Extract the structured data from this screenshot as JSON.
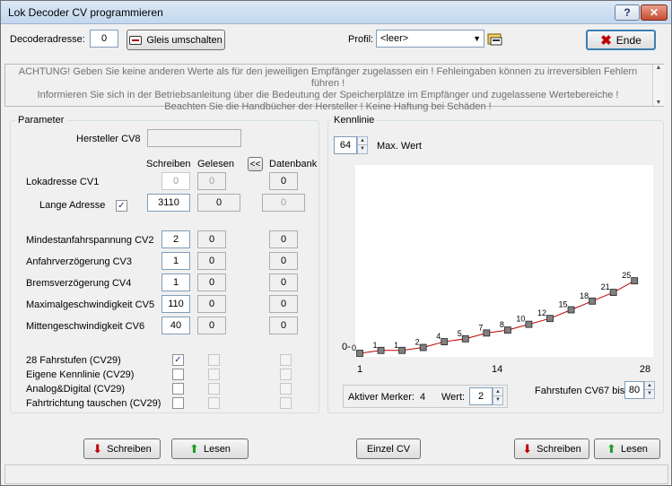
{
  "window": {
    "title": "Lok Decoder CV programmieren",
    "help_label": "?",
    "minimize_label": "—",
    "close_label": "✕"
  },
  "toolbar": {
    "decoder_label": "Decoderadresse:",
    "decoder_value": "0",
    "switch_track_label": "Gleis umschalten",
    "profile_label": "Profil:",
    "profile_value": "<leer>",
    "end_label": "Ende"
  },
  "warning": {
    "line1": "ACHTUNG! Geben Sie keine anderen Werte als für den jeweiligen Empfänger zugelassen ein ! Fehleingaben können zu irreversiblen Fehlern führen !",
    "line2": "Informieren Sie sich in der Betriebsanleitung über die Bedeutung der Speicherplätze im Empfänger und zugelassene Wertebereiche !",
    "line3": "Beachten Sie die Handbücher der Hersteller ! Keine Haftung bei Schäden !"
  },
  "parameters": {
    "group_title": "Parameter",
    "manufacturer_label": "Hersteller CV8",
    "manufacturer_value": "",
    "col_write": "Schreiben",
    "col_read": "Gelesen",
    "copy_button": "<<",
    "col_db": "Datenbank",
    "loco_address": {
      "label": "Lokadresse CV1",
      "write": "0",
      "read": "0",
      "db": "0"
    },
    "long_address": {
      "label": "Lange Adresse",
      "checked": "✓",
      "write": "3110",
      "read": "0",
      "db": "0"
    },
    "rows": [
      {
        "label": "Mindestanfahrspannung CV2",
        "write": "2",
        "read": "0",
        "db": "0"
      },
      {
        "label": "Anfahrverzögerung CV3",
        "write": "1",
        "read": "0",
        "db": "0"
      },
      {
        "label": "Bremsverzögerung CV4",
        "write": "1",
        "read": "0",
        "db": "0"
      },
      {
        "label": "Maximalgeschwindigkeit CV5",
        "write": "110",
        "read": "0",
        "db": "0"
      },
      {
        "label": "Mittengeschwindigkeit CV6",
        "write": "40",
        "read": "0",
        "db": "0"
      }
    ],
    "checks": [
      {
        "label": "28 Fahrstufen (CV29)",
        "mark": "✓"
      },
      {
        "label": "Eigene Kennlinie (CV29)",
        "mark": ""
      },
      {
        "label": "Analog&Digital (CV29)",
        "mark": ""
      },
      {
        "label": "Fahrtrichtung tauschen (CV29)",
        "mark": ""
      }
    ]
  },
  "curve": {
    "group_title": "Kennlinie",
    "max_value": "64",
    "max_label": "Max. Wert",
    "y_zero_label": "0-",
    "active_marker_label": "Aktiver Merker:",
    "active_marker_value": "4",
    "value_label": "Wert:",
    "value_value": "2",
    "steps_label": "Fahrstufen CV67 bis",
    "steps_value": "80"
  },
  "chart_data": {
    "type": "line",
    "x": [
      1,
      2,
      3,
      4,
      5,
      6,
      7,
      8,
      9,
      10,
      11,
      12,
      13,
      14
    ],
    "values": [
      0,
      1,
      1,
      2,
      4,
      5,
      7,
      8,
      10,
      12,
      15,
      18,
      21,
      25
    ],
    "xticks": [
      "1",
      "14",
      "28"
    ],
    "ylim": [
      0,
      64
    ]
  },
  "bottom": {
    "write_left": "Schreiben",
    "read_left": "Lesen",
    "single_cv": "Einzel CV",
    "write_right": "Schreiben",
    "read_right": "Lesen"
  },
  "colors": {
    "curve_line": "#c00000",
    "marker_fill": "#808080",
    "title_gradient": "#c3d7ee"
  }
}
